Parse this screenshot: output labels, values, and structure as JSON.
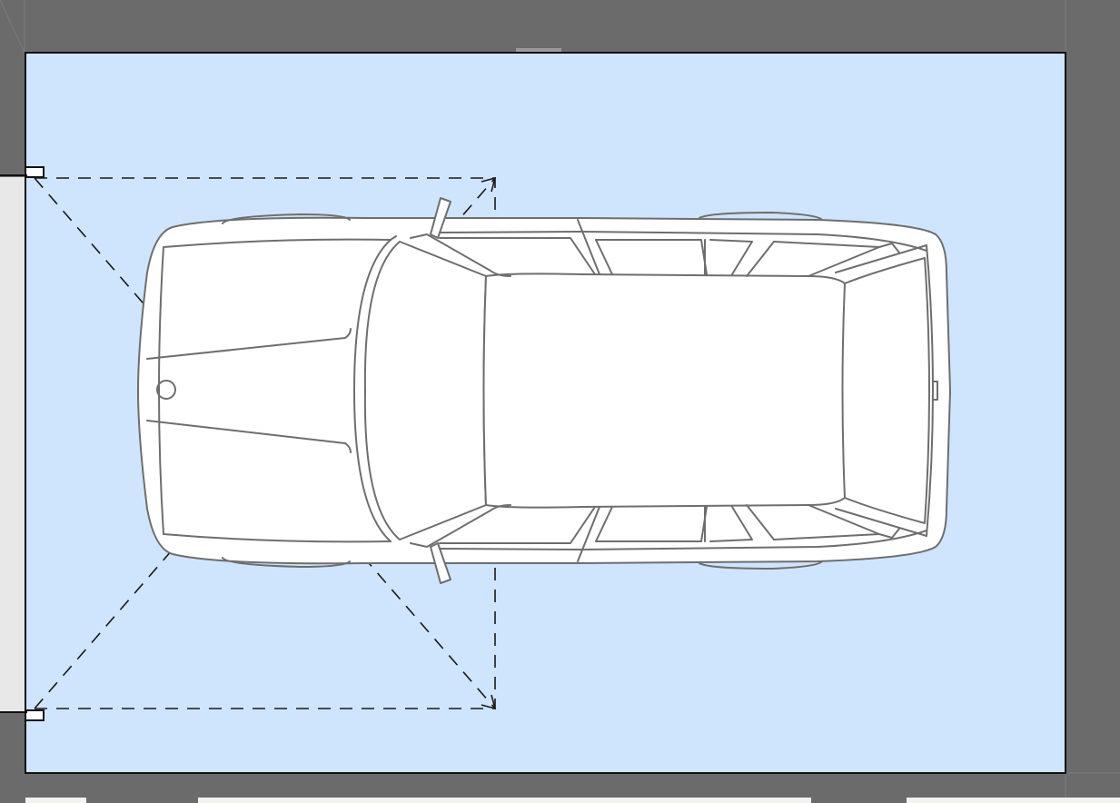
{
  "colors": {
    "wall": "#6b6b6b",
    "floor": "#cfe5fd",
    "floor_border": "#111111",
    "outside": "#e8e8e8",
    "car_body": "#ffffff",
    "car_outline": "#6e6e6e",
    "door_swing": "#1a1a1a",
    "bottom_strip": "#f3f3ee"
  },
  "icons": {
    "car": "car-top-view-icon",
    "door": "garage-door-icon"
  }
}
